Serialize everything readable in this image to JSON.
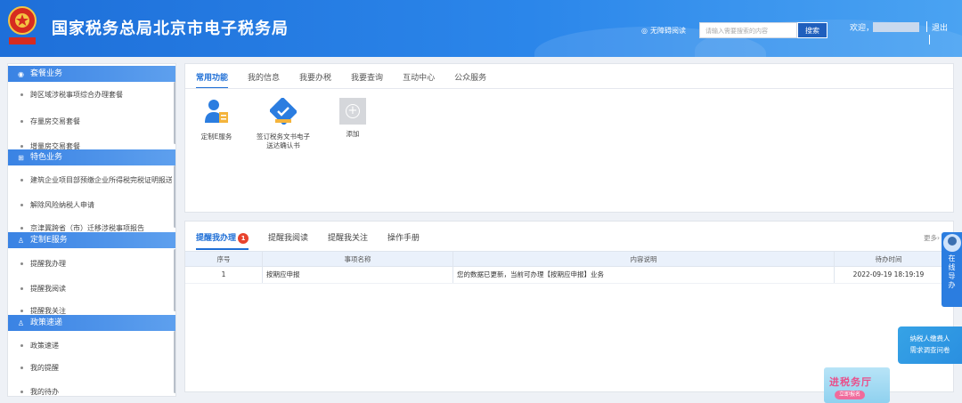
{
  "colors": {
    "header_blue": "#1e6fd9",
    "accent": "#1f6fd6",
    "badge_red": "#e8432d"
  },
  "header": {
    "title": "国家税务总局北京市电子税务局",
    "accessibility": "无障碍阅读",
    "search_placeholder": "请输入需要搜索的内容",
    "search_button": "搜索",
    "welcome": "欢迎，",
    "logout": "退出",
    "emblem_icon": "tax-emblem-icon"
  },
  "sidebar": {
    "sections": [
      {
        "label": "套餐业务",
        "icon": "package-icon",
        "items": [
          "跨区域涉税事项综合办理套餐",
          "存量房交易套餐",
          "增量房交易套餐"
        ]
      },
      {
        "label": "特色业务",
        "icon": "grid-icon",
        "items": [
          "建筑企业项目部预缴企业所得税完税证明报送",
          "解除风险纳税人申请",
          "京津冀跨省（市）迁移涉税事项报告"
        ]
      },
      {
        "label": "定制E服务",
        "icon": "user-icon",
        "items": [
          "提醒我办理",
          "提醒我阅读",
          "提醒我关注"
        ]
      },
      {
        "label": "政策速递",
        "icon": "user-icon",
        "items": [
          "政策速递",
          "我的提醒",
          "我的待办"
        ]
      }
    ]
  },
  "top_tabs": [
    "常用功能",
    "我的信息",
    "我要办税",
    "我要查询",
    "互动中心",
    "公众服务"
  ],
  "functions": [
    {
      "label": "定制E服务",
      "icon": "custom-service-icon"
    },
    {
      "label": "签订税务文书电子送达确认书",
      "icon": "sign-document-icon"
    },
    {
      "label": "添加",
      "icon": "add-icon"
    }
  ],
  "bottom_tabs": {
    "remind_handle": "提醒我办理",
    "remind_count": "1",
    "remind_read": "提醒我阅读",
    "remind_follow": "提醒我关注",
    "manual": "操作手册"
  },
  "more_label": "更多",
  "table": {
    "headers": [
      "序号",
      "事项名称",
      "内容说明",
      "待办时间"
    ],
    "rows": [
      [
        "1",
        "按期应申报",
        "您的数据已更新，当前可办理【按期应申报】业务",
        "2022-09-19 18:19:19"
      ]
    ]
  },
  "float_guide": "在线导办",
  "survey": {
    "line1": "纳税人缴费人",
    "line2": "需求调查问卷"
  },
  "promo": {
    "title": "进税务厅",
    "button": "立即报名"
  }
}
